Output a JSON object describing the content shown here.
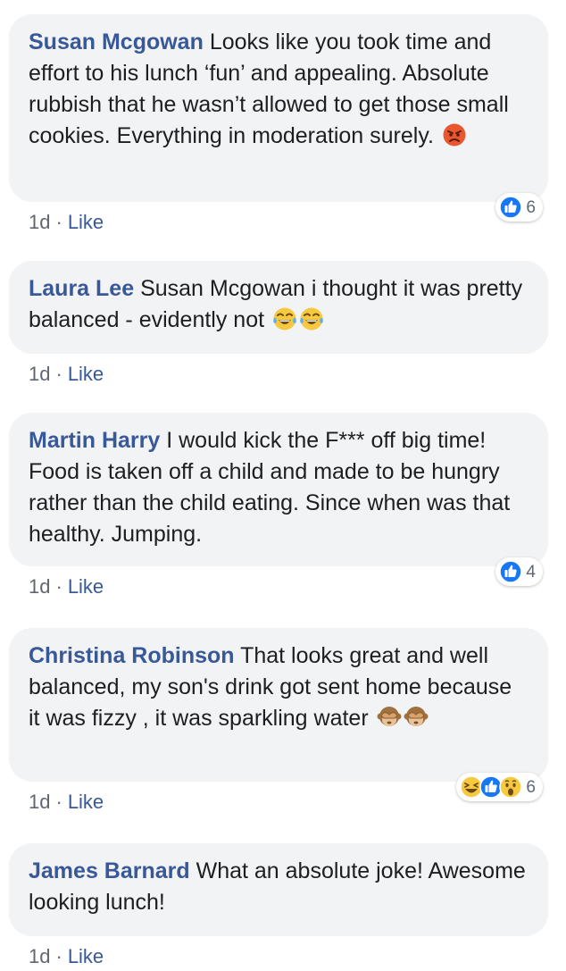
{
  "comments": [
    {
      "author": "Susan Mcgowan",
      "text": "Looks like you took time and effort to his lunch ‘fun’ and appealing. Absolute rubbish that he wasn’t allowed to get those small cookies. Everything in moderation surely.",
      "emojis": [
        "angry-face-emoji"
      ],
      "time": "1d",
      "separator": "·",
      "like_label": "Like",
      "reactions": [
        "like"
      ],
      "reaction_count": "6"
    },
    {
      "author": "Laura Lee",
      "text": "Susan Mcgowan i thought it was pretty balanced - evidently not",
      "emojis": [
        "tears-of-joy-emoji",
        "tears-of-joy-emoji"
      ],
      "time": "1d",
      "separator": "·",
      "like_label": "Like"
    },
    {
      "author": "Martin Harry",
      "text": "I would kick the F*** off big time! Food is taken off a child and made to be hungry rather than the child eating. Since when was that healthy. Jumping.",
      "time": "1d",
      "separator": "·",
      "like_label": "Like",
      "reactions": [
        "like"
      ],
      "reaction_count": "4"
    },
    {
      "author": "Christina Robinson",
      "text": "That looks great and well balanced, my son's drink got sent home because it was fizzy , it was sparkling water",
      "emojis": [
        "see-no-evil-monkey-emoji",
        "see-no-evil-monkey-emoji"
      ],
      "time": "1d",
      "separator": "·",
      "like_label": "Like",
      "reactions": [
        "haha",
        "like",
        "wow"
      ],
      "reaction_count": "6"
    },
    {
      "author": "James Barnard",
      "text": "What an absolute joke! Awesome looking lunch!",
      "time": "1d",
      "separator": "·",
      "like_label": "Like"
    }
  ],
  "colors": {
    "author": "#385898",
    "text": "#1c1e21",
    "bubble": "#f2f3f5",
    "meta": "#606770",
    "like_blue": "#1877f2",
    "reaction_yellow": "#f7c940"
  }
}
